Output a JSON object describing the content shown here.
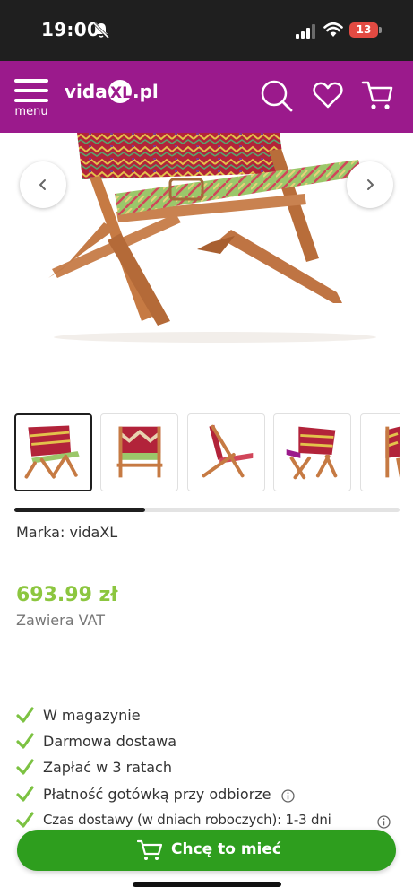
{
  "status_bar": {
    "time": "19:00",
    "battery": "13"
  },
  "header": {
    "menu_label": "menu",
    "logo_text_left": "vida",
    "logo_text_mark": "XL",
    "logo_text_right": ".pl",
    "brand_color": "#9b1a8c"
  },
  "gallery": {
    "prev_icon": "chevron-left-icon",
    "next_icon": "chevron-right-icon",
    "thumb_count": 5,
    "active_thumb": 1,
    "scroll_progress": 0.34
  },
  "product": {
    "brand_label": "Marka: vidaXL",
    "price": "693.99 zł",
    "price_color": "#8cc63f",
    "vat_note": "Zawiera VAT"
  },
  "features": [
    {
      "text": "W magazynie",
      "info": false
    },
    {
      "text": "Darmowa dostawa",
      "info": false
    },
    {
      "text": "Zapłać w 3 ratach",
      "info": false
    },
    {
      "text": "Płatność gotówką przy odbiorze",
      "info": true
    },
    {
      "text": "Czas dostawy (w dniach roboczych): 1-3 dni",
      "info": true
    }
  ],
  "cta": {
    "label": "Chcę to mieć",
    "color": "#2e9e1e"
  }
}
